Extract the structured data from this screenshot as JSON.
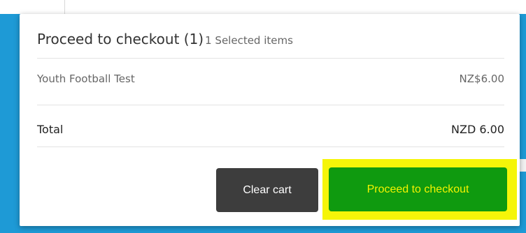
{
  "checkout_panel": {
    "title": "Proceed to checkout (1)",
    "subtitle": "1 Selected items",
    "items": [
      {
        "name": "Youth Football Test",
        "price": "NZ$6.00"
      }
    ],
    "total": {
      "label": "Total",
      "value": "NZD 6.00"
    },
    "actions": {
      "clear_label": "Clear cart",
      "checkout_label": "Proceed to checkout"
    }
  },
  "colors": {
    "background_accent": "#1e9ad6",
    "clear_button": "#3d3d3d",
    "checkout_button": "#0f9a0f",
    "checkout_text": "#f3f300",
    "highlight": "#f5f509"
  }
}
